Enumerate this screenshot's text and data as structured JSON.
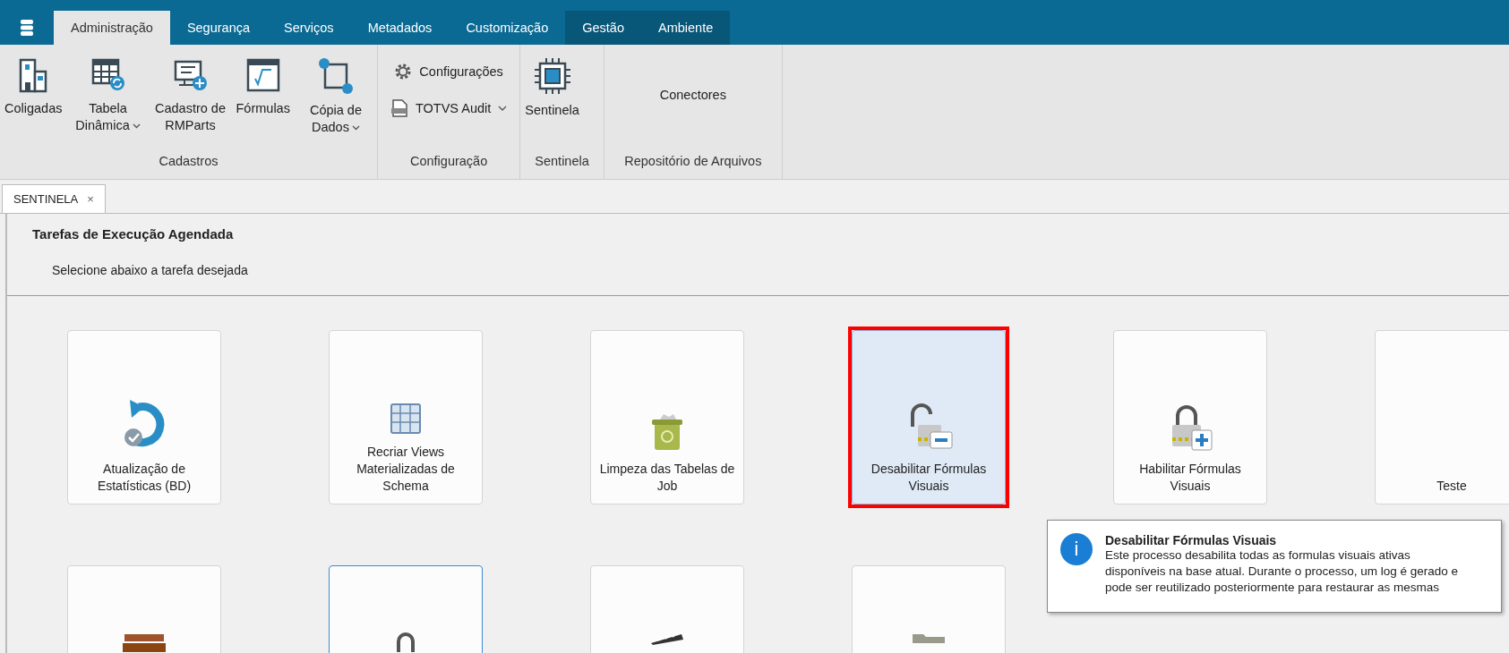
{
  "ribbon_tabs": [
    {
      "label": "Administração",
      "selected": true,
      "kind": "normal"
    },
    {
      "label": "Segurança",
      "selected": false,
      "kind": "normal"
    },
    {
      "label": "Serviços",
      "selected": false,
      "kind": "normal"
    },
    {
      "label": "Metadados",
      "selected": false,
      "kind": "normal"
    },
    {
      "label": "Customização",
      "selected": false,
      "kind": "normal"
    },
    {
      "label": "Gestão",
      "selected": false,
      "kind": "context"
    },
    {
      "label": "Ambiente",
      "selected": false,
      "kind": "context"
    }
  ],
  "ribbon_groups": [
    {
      "label": "Cadastros",
      "kind": "large",
      "items": [
        {
          "label": "Coligadas",
          "dropdown": false
        },
        {
          "label": "Tabela Dinâmica",
          "dropdown": true
        },
        {
          "label": "Cadastro de RMParts",
          "dropdown": false
        },
        {
          "label": "Fórmulas",
          "dropdown": false
        },
        {
          "label": "Cópia de Dados",
          "dropdown": true
        }
      ]
    },
    {
      "label": "Configuração",
      "kind": "small",
      "items": [
        {
          "label": "Configurações",
          "dropdown": false
        },
        {
          "label": "TOTVS Audit",
          "dropdown": true
        }
      ]
    },
    {
      "label": "Sentinela",
      "kind": "large",
      "items": [
        {
          "label": "Sentinela",
          "dropdown": false
        }
      ]
    },
    {
      "label": "Repositório de Arquivos",
      "kind": "text",
      "items": [
        {
          "label": "Conectores"
        }
      ]
    }
  ],
  "document_tab": {
    "label": "SENTINELA",
    "close": "×"
  },
  "heading": "Tarefas de Execução Agendada",
  "instruction": "Selecione abaixo a tarefa desejada",
  "task_rows": [
    [
      {
        "label": "Atualização de Estatísticas (BD)",
        "selected": false,
        "focused": false,
        "annotated": false
      },
      {
        "label": "Recriar Views Materializadas de Schema",
        "selected": false,
        "focused": false,
        "annotated": false
      },
      {
        "label": "Limpeza das Tabelas de Job",
        "selected": false,
        "focused": false,
        "annotated": false
      },
      {
        "label": "Desabilitar Fórmulas Visuais",
        "selected": true,
        "focused": false,
        "annotated": true
      },
      {
        "label": "Habilitar Fórmulas Visuais",
        "selected": false,
        "focused": false,
        "annotated": false
      },
      {
        "label": "Teste",
        "selected": false,
        "focused": false,
        "annotated": false
      }
    ],
    [
      {
        "selected": false,
        "focused": false,
        "annotated": false
      },
      {
        "selected": false,
        "focused": true,
        "annotated": false
      },
      {
        "selected": false,
        "focused": false,
        "annotated": false
      },
      {
        "selected": false,
        "focused": false,
        "annotated": false
      }
    ]
  ],
  "tooltip": {
    "title": "Desabilitar Fórmulas Visuais",
    "icon_glyph": "i",
    "text": "Este processo desabilita todas as formulas visuais ativas disponíveis na base atual. Durante o processo, um log é gerado e pode ser reutilizado posteriormente para restaurar as mesmas"
  }
}
